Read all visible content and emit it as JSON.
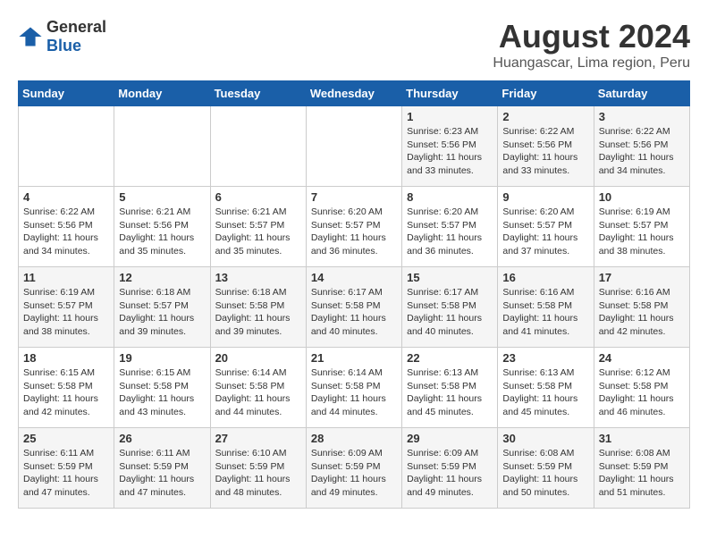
{
  "logo": {
    "general": "General",
    "blue": "Blue"
  },
  "title": "August 2024",
  "subtitle": "Huangascar, Lima region, Peru",
  "header_days": [
    "Sunday",
    "Monday",
    "Tuesday",
    "Wednesday",
    "Thursday",
    "Friday",
    "Saturday"
  ],
  "weeks": [
    [
      {
        "day": "",
        "detail": ""
      },
      {
        "day": "",
        "detail": ""
      },
      {
        "day": "",
        "detail": ""
      },
      {
        "day": "",
        "detail": ""
      },
      {
        "day": "1",
        "detail": "Sunrise: 6:23 AM\nSunset: 5:56 PM\nDaylight: 11 hours\nand 33 minutes."
      },
      {
        "day": "2",
        "detail": "Sunrise: 6:22 AM\nSunset: 5:56 PM\nDaylight: 11 hours\nand 33 minutes."
      },
      {
        "day": "3",
        "detail": "Sunrise: 6:22 AM\nSunset: 5:56 PM\nDaylight: 11 hours\nand 34 minutes."
      }
    ],
    [
      {
        "day": "4",
        "detail": "Sunrise: 6:22 AM\nSunset: 5:56 PM\nDaylight: 11 hours\nand 34 minutes."
      },
      {
        "day": "5",
        "detail": "Sunrise: 6:21 AM\nSunset: 5:56 PM\nDaylight: 11 hours\nand 35 minutes."
      },
      {
        "day": "6",
        "detail": "Sunrise: 6:21 AM\nSunset: 5:57 PM\nDaylight: 11 hours\nand 35 minutes."
      },
      {
        "day": "7",
        "detail": "Sunrise: 6:20 AM\nSunset: 5:57 PM\nDaylight: 11 hours\nand 36 minutes."
      },
      {
        "day": "8",
        "detail": "Sunrise: 6:20 AM\nSunset: 5:57 PM\nDaylight: 11 hours\nand 36 minutes."
      },
      {
        "day": "9",
        "detail": "Sunrise: 6:20 AM\nSunset: 5:57 PM\nDaylight: 11 hours\nand 37 minutes."
      },
      {
        "day": "10",
        "detail": "Sunrise: 6:19 AM\nSunset: 5:57 PM\nDaylight: 11 hours\nand 38 minutes."
      }
    ],
    [
      {
        "day": "11",
        "detail": "Sunrise: 6:19 AM\nSunset: 5:57 PM\nDaylight: 11 hours\nand 38 minutes."
      },
      {
        "day": "12",
        "detail": "Sunrise: 6:18 AM\nSunset: 5:57 PM\nDaylight: 11 hours\nand 39 minutes."
      },
      {
        "day": "13",
        "detail": "Sunrise: 6:18 AM\nSunset: 5:58 PM\nDaylight: 11 hours\nand 39 minutes."
      },
      {
        "day": "14",
        "detail": "Sunrise: 6:17 AM\nSunset: 5:58 PM\nDaylight: 11 hours\nand 40 minutes."
      },
      {
        "day": "15",
        "detail": "Sunrise: 6:17 AM\nSunset: 5:58 PM\nDaylight: 11 hours\nand 40 minutes."
      },
      {
        "day": "16",
        "detail": "Sunrise: 6:16 AM\nSunset: 5:58 PM\nDaylight: 11 hours\nand 41 minutes."
      },
      {
        "day": "17",
        "detail": "Sunrise: 6:16 AM\nSunset: 5:58 PM\nDaylight: 11 hours\nand 42 minutes."
      }
    ],
    [
      {
        "day": "18",
        "detail": "Sunrise: 6:15 AM\nSunset: 5:58 PM\nDaylight: 11 hours\nand 42 minutes."
      },
      {
        "day": "19",
        "detail": "Sunrise: 6:15 AM\nSunset: 5:58 PM\nDaylight: 11 hours\nand 43 minutes."
      },
      {
        "day": "20",
        "detail": "Sunrise: 6:14 AM\nSunset: 5:58 PM\nDaylight: 11 hours\nand 44 minutes."
      },
      {
        "day": "21",
        "detail": "Sunrise: 6:14 AM\nSunset: 5:58 PM\nDaylight: 11 hours\nand 44 minutes."
      },
      {
        "day": "22",
        "detail": "Sunrise: 6:13 AM\nSunset: 5:58 PM\nDaylight: 11 hours\nand 45 minutes."
      },
      {
        "day": "23",
        "detail": "Sunrise: 6:13 AM\nSunset: 5:58 PM\nDaylight: 11 hours\nand 45 minutes."
      },
      {
        "day": "24",
        "detail": "Sunrise: 6:12 AM\nSunset: 5:58 PM\nDaylight: 11 hours\nand 46 minutes."
      }
    ],
    [
      {
        "day": "25",
        "detail": "Sunrise: 6:11 AM\nSunset: 5:59 PM\nDaylight: 11 hours\nand 47 minutes."
      },
      {
        "day": "26",
        "detail": "Sunrise: 6:11 AM\nSunset: 5:59 PM\nDaylight: 11 hours\nand 47 minutes."
      },
      {
        "day": "27",
        "detail": "Sunrise: 6:10 AM\nSunset: 5:59 PM\nDaylight: 11 hours\nand 48 minutes."
      },
      {
        "day": "28",
        "detail": "Sunrise: 6:09 AM\nSunset: 5:59 PM\nDaylight: 11 hours\nand 49 minutes."
      },
      {
        "day": "29",
        "detail": "Sunrise: 6:09 AM\nSunset: 5:59 PM\nDaylight: 11 hours\nand 49 minutes."
      },
      {
        "day": "30",
        "detail": "Sunrise: 6:08 AM\nSunset: 5:59 PM\nDaylight: 11 hours\nand 50 minutes."
      },
      {
        "day": "31",
        "detail": "Sunrise: 6:08 AM\nSunset: 5:59 PM\nDaylight: 11 hours\nand 51 minutes."
      }
    ]
  ]
}
